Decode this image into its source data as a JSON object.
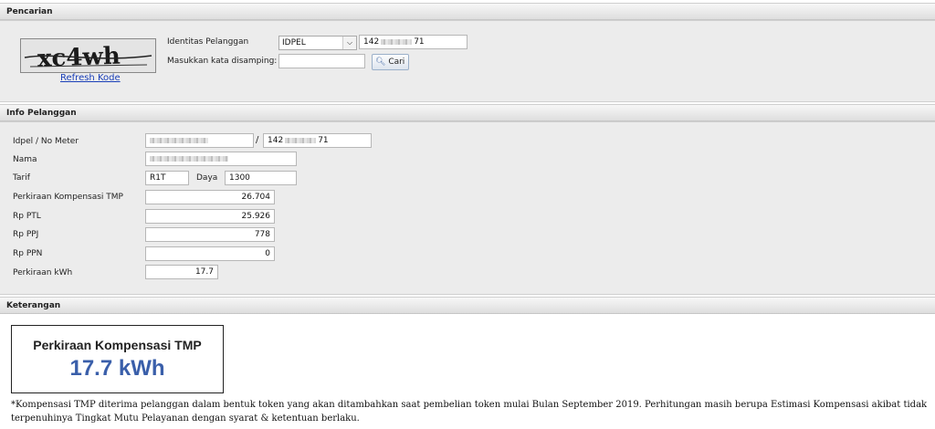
{
  "search": {
    "title": "Pencarian",
    "captcha_text": "xc4wh",
    "refresh_label": "Refresh Kode",
    "id_label": "Identitas Pelanggan",
    "id_type": "IDPEL",
    "id_value_prefix": "142",
    "id_value_suffix": "71",
    "code_label": "Masukkan kata disamping:",
    "code_value": "",
    "search_button": "Cari"
  },
  "info": {
    "title": "Info Pelanggan",
    "idpel_label": "Idpel / No Meter",
    "separator": "/",
    "meter_prefix": "142",
    "meter_suffix": "71",
    "nama_label": "Nama",
    "tarif_label": "Tarif",
    "tarif_value": "R1T",
    "daya_label": "Daya",
    "daya_value": "1300",
    "rows": [
      {
        "label": "Perkiraan Kompensasi TMP",
        "value": "26.704"
      },
      {
        "label": "Rp PTL",
        "value": "25.926"
      },
      {
        "label": "Rp PPJ",
        "value": "778"
      },
      {
        "label": "Rp PPN",
        "value": "0"
      },
      {
        "label": "Perkiraan kWh",
        "value": "17.7"
      }
    ]
  },
  "keterangan": {
    "title": "Keterangan",
    "box_title": "Perkiraan Kompensasi TMP",
    "box_value": "17.7 kWh",
    "value_color": "#3a5faa",
    "note": "*Kompensasi TMP diterima pelanggan dalam bentuk token yang akan ditambahkan saat pembelian token mulai Bulan September 2019. Perhitungan masih berupa Estimasi Kompensasi akibat tidak terpenuhinya Tingkat Mutu Pelayanan dengan syarat & ketentuan berlaku."
  }
}
